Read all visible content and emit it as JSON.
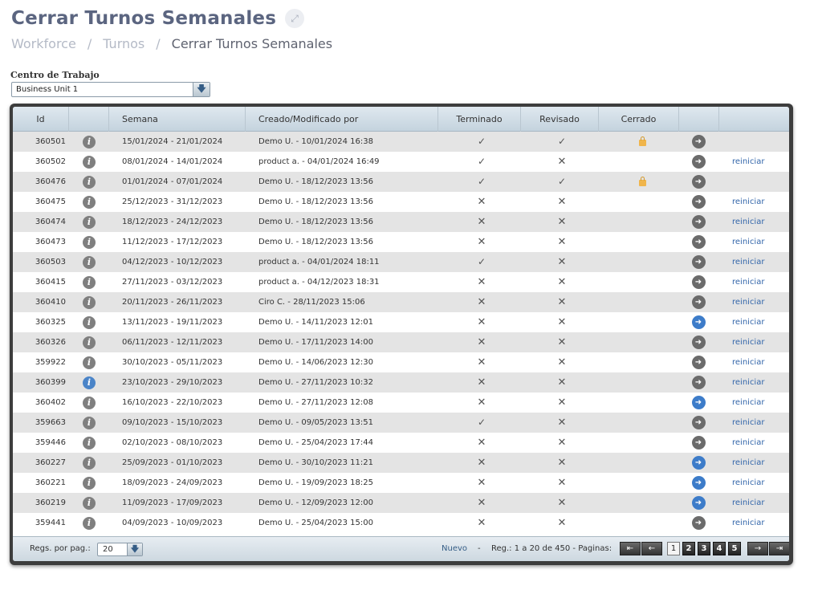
{
  "page": {
    "title": "Cerrar Turnos Semanales"
  },
  "breadcrumb": {
    "items": [
      "Workforce",
      "Turnos"
    ],
    "separator": "/",
    "current": "Cerrar Turnos Semanales"
  },
  "filter": {
    "label": "Centro de Trabajo",
    "value": "Business Unit 1"
  },
  "table": {
    "columns": {
      "id": "Id",
      "week": "Semana",
      "by": "Creado/Modificado por",
      "finished": "Terminado",
      "reviewed": "Revisado",
      "closed": "Cerrado"
    },
    "rows": [
      {
        "id": "360501",
        "info": "gray",
        "week": "15/01/2024 - 21/01/2024",
        "by": "Demo U. - 10/01/2024 16:38",
        "finished": "✓",
        "reviewed": "✓",
        "locked": true,
        "go": "gray",
        "reset": ""
      },
      {
        "id": "360502",
        "info": "gray",
        "week": "08/01/2024 - 14/01/2024",
        "by": "product a. - 04/01/2024 16:49",
        "finished": "✓",
        "reviewed": "✕",
        "locked": false,
        "go": "gray",
        "reset": "reiniciar"
      },
      {
        "id": "360476",
        "info": "gray",
        "week": "01/01/2024 - 07/01/2024",
        "by": "Demo U. - 18/12/2023 13:56",
        "finished": "✓",
        "reviewed": "✓",
        "locked": true,
        "go": "gray",
        "reset": ""
      },
      {
        "id": "360475",
        "info": "gray",
        "week": "25/12/2023 - 31/12/2023",
        "by": "Demo U. - 18/12/2023 13:56",
        "finished": "✕",
        "reviewed": "✕",
        "locked": false,
        "go": "gray",
        "reset": "reiniciar"
      },
      {
        "id": "360474",
        "info": "gray",
        "week": "18/12/2023 - 24/12/2023",
        "by": "Demo U. - 18/12/2023 13:56",
        "finished": "✕",
        "reviewed": "✕",
        "locked": false,
        "go": "gray",
        "reset": "reiniciar"
      },
      {
        "id": "360473",
        "info": "gray",
        "week": "11/12/2023 - 17/12/2023",
        "by": "Demo U. - 18/12/2023 13:56",
        "finished": "✕",
        "reviewed": "✕",
        "locked": false,
        "go": "gray",
        "reset": "reiniciar"
      },
      {
        "id": "360503",
        "info": "gray",
        "week": "04/12/2023 - 10/12/2023",
        "by": "product a. - 04/01/2024 18:11",
        "finished": "✓",
        "reviewed": "✕",
        "locked": false,
        "go": "gray",
        "reset": "reiniciar"
      },
      {
        "id": "360415",
        "info": "gray",
        "week": "27/11/2023 - 03/12/2023",
        "by": "product a. - 04/12/2023 18:31",
        "finished": "✕",
        "reviewed": "✕",
        "locked": false,
        "go": "gray",
        "reset": "reiniciar"
      },
      {
        "id": "360410",
        "info": "gray",
        "week": "20/11/2023 - 26/11/2023",
        "by": "Ciro C. - 28/11/2023 15:06",
        "finished": "✕",
        "reviewed": "✕",
        "locked": false,
        "go": "gray",
        "reset": "reiniciar"
      },
      {
        "id": "360325",
        "info": "gray",
        "week": "13/11/2023 - 19/11/2023",
        "by": "Demo U. - 14/11/2023 12:01",
        "finished": "✕",
        "reviewed": "✕",
        "locked": false,
        "go": "blue",
        "reset": "reiniciar"
      },
      {
        "id": "360326",
        "info": "gray",
        "week": "06/11/2023 - 12/11/2023",
        "by": "Demo U. - 17/11/2023 14:00",
        "finished": "✕",
        "reviewed": "✕",
        "locked": false,
        "go": "gray",
        "reset": "reiniciar"
      },
      {
        "id": "359922",
        "info": "gray",
        "week": "30/10/2023 - 05/11/2023",
        "by": "Demo U. - 14/06/2023 12:30",
        "finished": "✕",
        "reviewed": "✕",
        "locked": false,
        "go": "gray",
        "reset": "reiniciar"
      },
      {
        "id": "360399",
        "info": "blue",
        "week": "23/10/2023 - 29/10/2023",
        "by": "Demo U. - 27/11/2023 10:32",
        "finished": "✕",
        "reviewed": "✕",
        "locked": false,
        "go": "gray",
        "reset": "reiniciar"
      },
      {
        "id": "360402",
        "info": "gray",
        "week": "16/10/2023 - 22/10/2023",
        "by": "Demo U. - 27/11/2023 12:08",
        "finished": "✕",
        "reviewed": "✕",
        "locked": false,
        "go": "blue",
        "reset": "reiniciar"
      },
      {
        "id": "359663",
        "info": "gray",
        "week": "09/10/2023 - 15/10/2023",
        "by": "Demo U. - 09/05/2023 13:51",
        "finished": "✓",
        "reviewed": "✕",
        "locked": false,
        "go": "gray",
        "reset": "reiniciar"
      },
      {
        "id": "359446",
        "info": "gray",
        "week": "02/10/2023 - 08/10/2023",
        "by": "Demo U. - 25/04/2023 17:44",
        "finished": "✕",
        "reviewed": "✕",
        "locked": false,
        "go": "gray",
        "reset": "reiniciar"
      },
      {
        "id": "360227",
        "info": "gray",
        "week": "25/09/2023 - 01/10/2023",
        "by": "Demo U. - 30/10/2023 11:21",
        "finished": "✕",
        "reviewed": "✕",
        "locked": false,
        "go": "blue",
        "reset": "reiniciar"
      },
      {
        "id": "360221",
        "info": "gray",
        "week": "18/09/2023 - 24/09/2023",
        "by": "Demo U. - 19/09/2023 18:25",
        "finished": "✕",
        "reviewed": "✕",
        "locked": false,
        "go": "blue",
        "reset": "reiniciar"
      },
      {
        "id": "360219",
        "info": "gray",
        "week": "11/09/2023 - 17/09/2023",
        "by": "Demo U. - 12/09/2023 12:00",
        "finished": "✕",
        "reviewed": "✕",
        "locked": false,
        "go": "blue",
        "reset": "reiniciar"
      },
      {
        "id": "359441",
        "info": "gray",
        "week": "04/09/2023 - 10/09/2023",
        "by": "Demo U. - 25/04/2023 15:00",
        "finished": "✕",
        "reviewed": "✕",
        "locked": false,
        "go": "gray",
        "reset": "reiniciar"
      }
    ]
  },
  "footer": {
    "per_page_label": "Regs. por pag.:",
    "per_page_value": "20",
    "new_label": "Nuevo",
    "dash": "-",
    "reg_info": "Reg.: 1 a 20 de 450 - Paginas:",
    "pages": [
      "1",
      "2",
      "3",
      "4",
      "5"
    ],
    "current_page": "1"
  },
  "colors": {
    "title": "#5b6580",
    "link": "#3366aa",
    "info_blue": "#4a84c8",
    "lock": "#f0b54b"
  }
}
